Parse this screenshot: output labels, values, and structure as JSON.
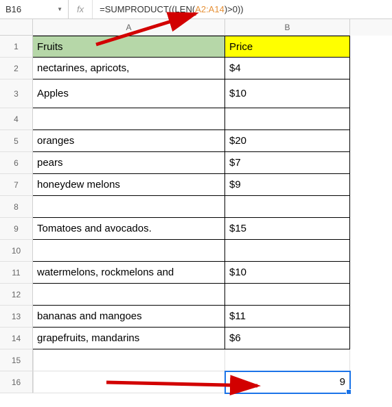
{
  "name_box": "B16",
  "fx_label": "fx",
  "formula": {
    "prefix": "=SUMPRODUCT((LEN(",
    "range": "A2:A14",
    "suffix": ")>0))"
  },
  "columns": {
    "a": "A",
    "b": "B"
  },
  "rows": [
    {
      "n": "1",
      "a": "Fruits",
      "b": "Price",
      "header": true
    },
    {
      "n": "2",
      "a": "nectarines, apricots,",
      "b": "$4"
    },
    {
      "n": "3",
      "a": "Apples",
      "b": "$10"
    },
    {
      "n": "4",
      "a": "",
      "b": ""
    },
    {
      "n": "5",
      "a": "oranges",
      "b": "$20"
    },
    {
      "n": "6",
      "a": "pears",
      "b": "$7"
    },
    {
      "n": "7",
      "a": "honeydew melons",
      "b": "$9"
    },
    {
      "n": "8",
      "a": "",
      "b": ""
    },
    {
      "n": "9",
      "a": "Tomatoes and avocados.",
      "b": "$15"
    },
    {
      "n": "10",
      "a": "",
      "b": ""
    },
    {
      "n": "11",
      "a": "watermelons, rockmelons and",
      "b": "$10"
    },
    {
      "n": "12",
      "a": "",
      "b": ""
    },
    {
      "n": "13",
      "a": "bananas and mangoes",
      "b": "$11"
    },
    {
      "n": "14",
      "a": "grapefruits, mandarins",
      "b": "$6"
    },
    {
      "n": "15",
      "a": "",
      "b": "",
      "grid": true
    },
    {
      "n": "16",
      "a": "",
      "b": "9",
      "grid": true,
      "selected": "b"
    }
  ]
}
